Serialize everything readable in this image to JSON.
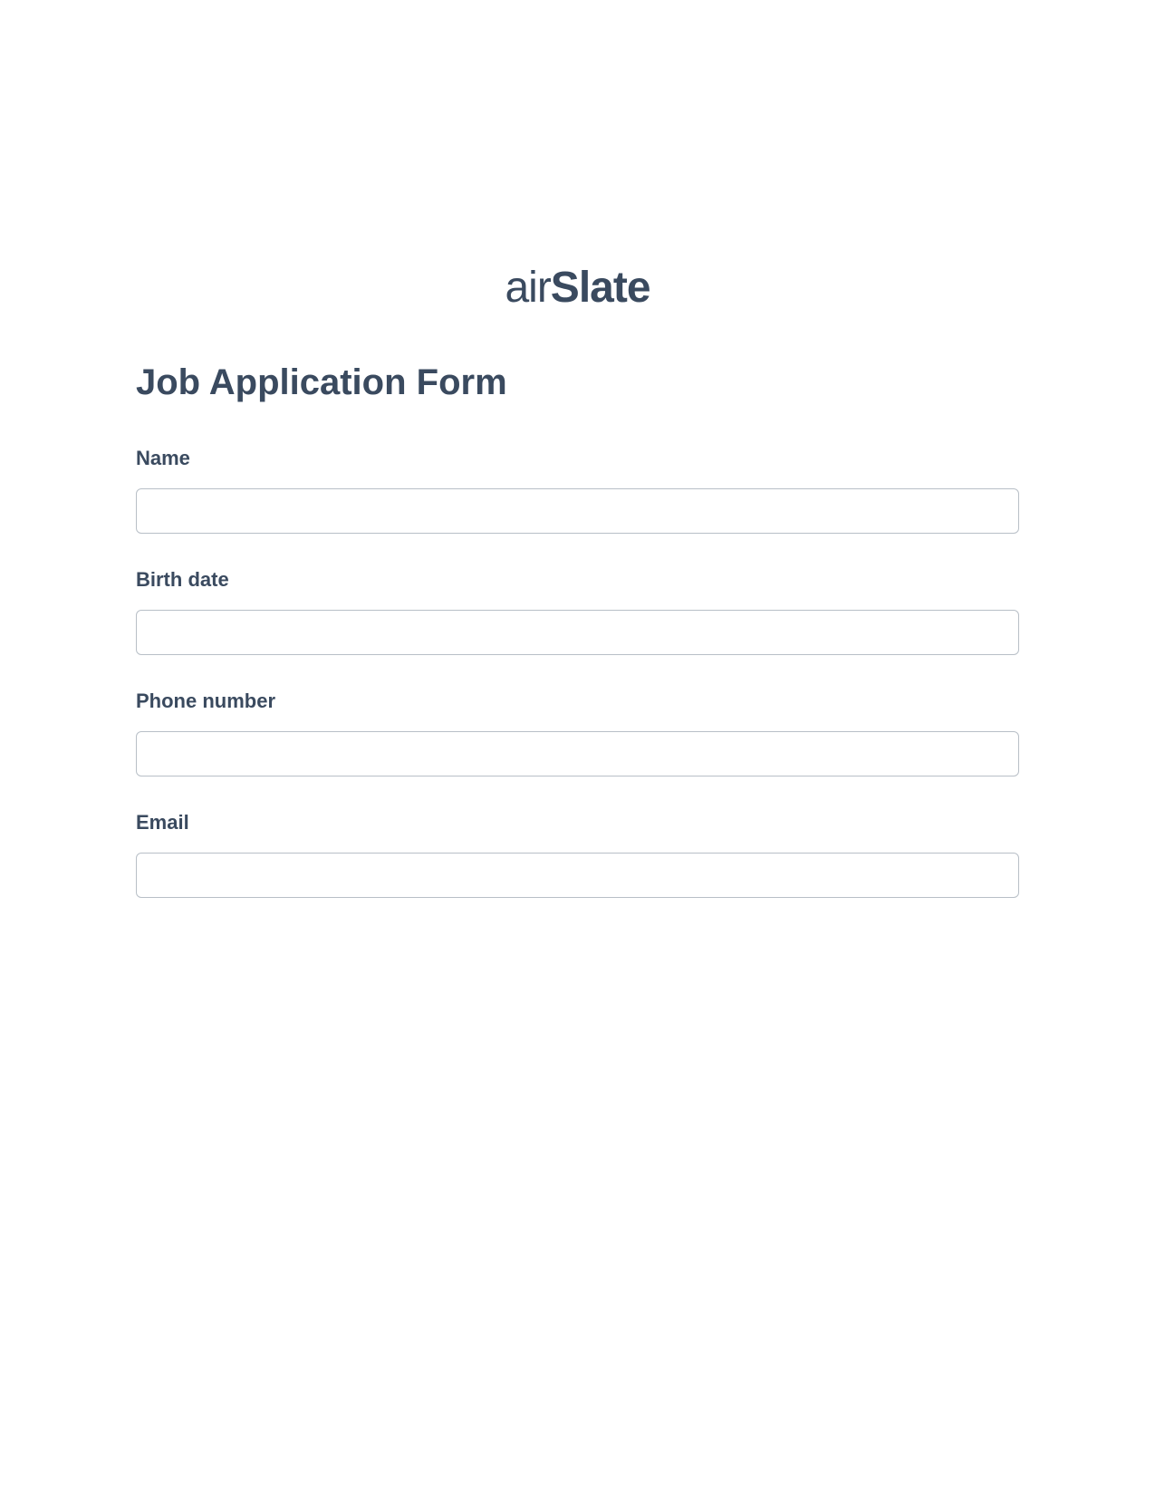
{
  "logo": {
    "text_light": "air",
    "text_bold": "Slate"
  },
  "form": {
    "title": "Job Application Form",
    "fields": [
      {
        "label": "Name",
        "value": ""
      },
      {
        "label": "Birth date",
        "value": ""
      },
      {
        "label": "Phone number",
        "value": ""
      },
      {
        "label": "Email",
        "value": ""
      }
    ]
  }
}
